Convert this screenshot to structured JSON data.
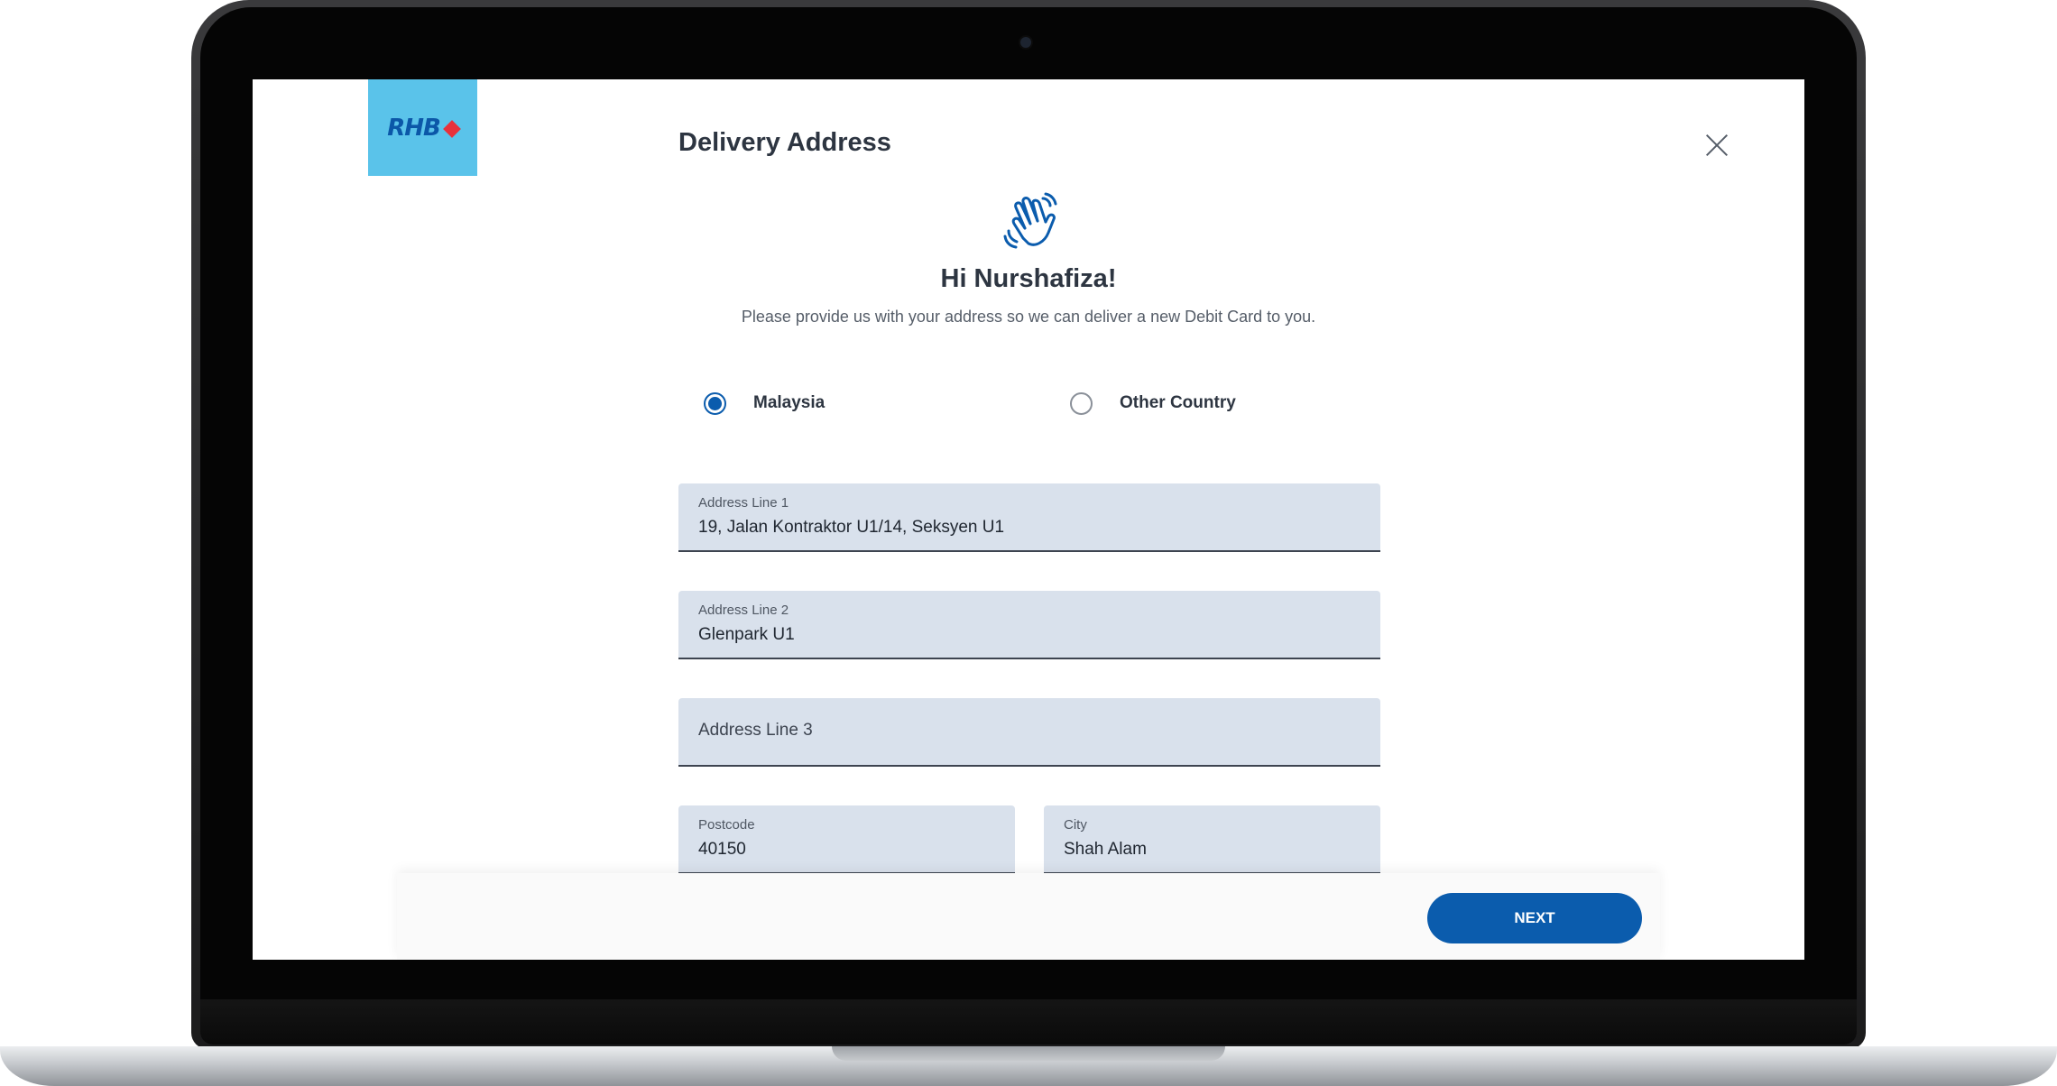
{
  "app": {
    "logo_text": "RHB",
    "title": "Delivery Address"
  },
  "greeting": {
    "headline": "Hi Nurshafiza!",
    "message": "Please provide us with your address so we can deliver a new Debit Card to you."
  },
  "country_options": [
    {
      "label": "Malaysia",
      "selected": true
    },
    {
      "label": "Other Country",
      "selected": false
    }
  ],
  "form": {
    "address_line_1": {
      "label": "Address Line 1",
      "value": "19, Jalan Kontraktor U1/14, Seksyen U1"
    },
    "address_line_2": {
      "label": "Address Line 2",
      "value": "Glenpark U1"
    },
    "address_line_3": {
      "placeholder": "Address Line 3"
    },
    "postcode": {
      "label": "Postcode",
      "value": "40150"
    },
    "city": {
      "label": "City",
      "value": "Shah Alam"
    }
  },
  "actions": {
    "next_label": "NEXT"
  },
  "colors": {
    "brand_blue": "#0b5cad",
    "logo_background": "#5ac3ea",
    "logo_accent": "#e8313b",
    "field_background": "#d9e1ec"
  }
}
